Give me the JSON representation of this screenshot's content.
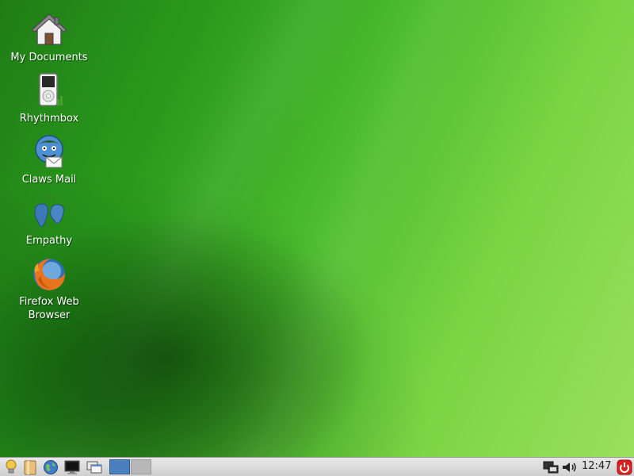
{
  "desktop": {
    "icons": [
      {
        "label": "My Documents",
        "icon": "home-folder-icon"
      },
      {
        "label": "Rhythmbox",
        "icon": "music-player-icon"
      },
      {
        "label": "Claws Mail",
        "icon": "mail-client-icon"
      },
      {
        "label": "Empathy",
        "icon": "chat-client-icon"
      },
      {
        "label": "Firefox Web Browser",
        "icon": "firefox-icon"
      }
    ]
  },
  "taskbar": {
    "launchers": [
      "menu-bulb-icon",
      "file-manager-icon",
      "web-browser-icon",
      "terminal-icon",
      "show-desktop-icon"
    ],
    "pager": {
      "workspaces": 2,
      "active": 1
    },
    "tray": [
      "network-icon",
      "volume-icon"
    ],
    "clock": "12:47",
    "power": "power-icon"
  },
  "colors": {
    "accent": "#4a7fc0",
    "taskbar": "#d8d8d8",
    "power": "#e02020"
  }
}
